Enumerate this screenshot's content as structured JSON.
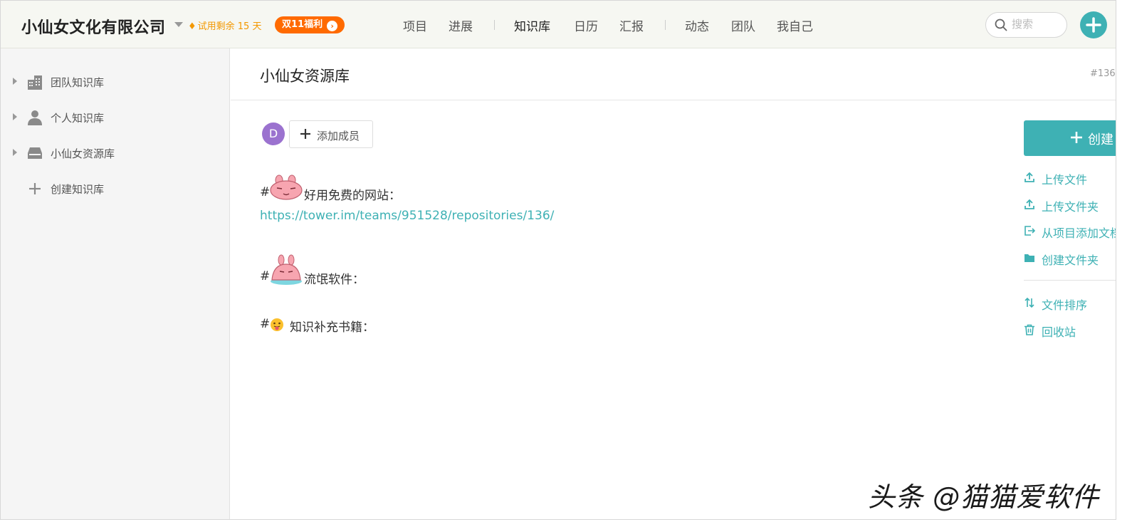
{
  "header": {
    "brand": "小仙女文化有限公司",
    "trial": "试用剩余 15 天",
    "promo": "双11福利",
    "nav": [
      {
        "label": "项目",
        "active": false
      },
      {
        "label": "进展",
        "active": false
      },
      {
        "label": "知识库",
        "active": true
      },
      {
        "label": "日历",
        "active": false
      },
      {
        "label": "汇报",
        "active": false
      },
      {
        "label": "动态",
        "active": false
      },
      {
        "label": "团队",
        "active": false
      },
      {
        "label": "我自己",
        "active": false
      }
    ],
    "search_placeholder": "搜索"
  },
  "sidebar": {
    "items": [
      {
        "label": "团队知识库",
        "icon": "building-icon"
      },
      {
        "label": "个人知识库",
        "icon": "person-icon"
      },
      {
        "label": "小仙女资源库",
        "icon": "drive-icon"
      },
      {
        "label": "创建知识库",
        "icon": "plus-icon"
      }
    ]
  },
  "main": {
    "title": "小仙女资源库",
    "id": "#136",
    "member_initial": "D",
    "add_member_label": "添加成员",
    "lines": [
      {
        "prefix": "#",
        "emoji": "pink-bunny-face",
        "text": "好用免费的网站："
      },
      {
        "link": "https://tower.im/teams/951528/repositories/136/"
      },
      {
        "prefix": "#",
        "emoji": "pink-bunny-melting",
        "text": "流氓软件："
      },
      {
        "prefix": "#",
        "emoji": "😛",
        "text": "知识补充书籍："
      }
    ]
  },
  "actions": {
    "create_label": "创建",
    "items": [
      {
        "label": "上传文件",
        "icon": "upload-icon"
      },
      {
        "label": "上传文件夹",
        "icon": "upload-folder-icon"
      },
      {
        "label": "从项目添加文档",
        "icon": "import-icon"
      },
      {
        "label": "创建文件夹",
        "icon": "folder-icon"
      },
      {
        "label": "文件排序",
        "icon": "sort-icon"
      },
      {
        "label": "回收站",
        "icon": "trash-icon"
      }
    ]
  },
  "watermark": "头条 @猫猫爱软件",
  "colors": {
    "accent": "#3eb1b4",
    "promo": "#ff6a00",
    "trial": "#f39800",
    "avatar": "#9b72cf"
  }
}
